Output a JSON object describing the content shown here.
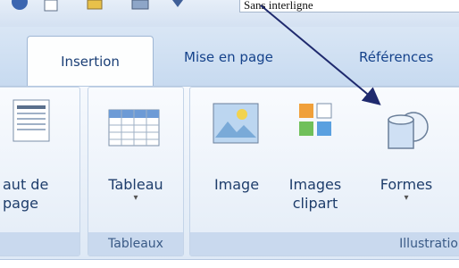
{
  "document": {
    "title_fragment": "Sans interligne"
  },
  "tabs": [
    {
      "label": "Insertion"
    },
    {
      "label": "Mise en page"
    },
    {
      "label": "Références"
    }
  ],
  "groups": {
    "header": {
      "button": {
        "line1": "aut de",
        "line2": "page"
      }
    },
    "tables": {
      "label": "Tableaux",
      "button": {
        "label": "Tableau",
        "arrow": "▾"
      }
    },
    "illustrations": {
      "label": "Illustratio",
      "image": {
        "label": "Image"
      },
      "clipart": {
        "line1": "Images",
        "line2": "clipart"
      },
      "shapes": {
        "label": "Formes",
        "arrow": "▾"
      }
    }
  },
  "colors": {
    "accent": "#15428b",
    "ribbon": "#dde8f5",
    "arrow_annotation": "#1f2a6e"
  }
}
